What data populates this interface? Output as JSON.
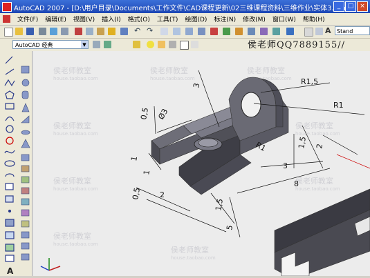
{
  "window": {
    "title": "AutoCAD 2007 - [D:\\用户目录\\Documents\\工作文件\\CAD课程更新\\02三维课程资料\\三维作业\\实体3.dwg]",
    "min_label": "_",
    "max_label": "□",
    "close_label": "×"
  },
  "menu": {
    "items": [
      "文件(F)",
      "编辑(E)",
      "视图(V)",
      "插入(I)",
      "格式(O)",
      "工具(T)",
      "绘图(D)",
      "标注(N)",
      "修改(M)",
      "窗口(W)",
      "帮助(H)"
    ]
  },
  "toolbar": {
    "workspace_value": "AutoCAD 经典",
    "text_style_value": "Stand",
    "text_style_icon": "text-style-icon"
  },
  "watermark": {
    "qq_text": "侯老师QQ7889155//",
    "text_cn": "侯老师教室",
    "text_en": "house.taobao.com"
  },
  "drawing": {
    "dimensions": [
      "R1,5",
      "R1",
      "3",
      "0,5",
      "Ø3",
      "R1",
      "1,5",
      "2",
      "3",
      "8",
      "1",
      "1",
      "0,5",
      "2",
      "1,5",
      "5"
    ]
  }
}
